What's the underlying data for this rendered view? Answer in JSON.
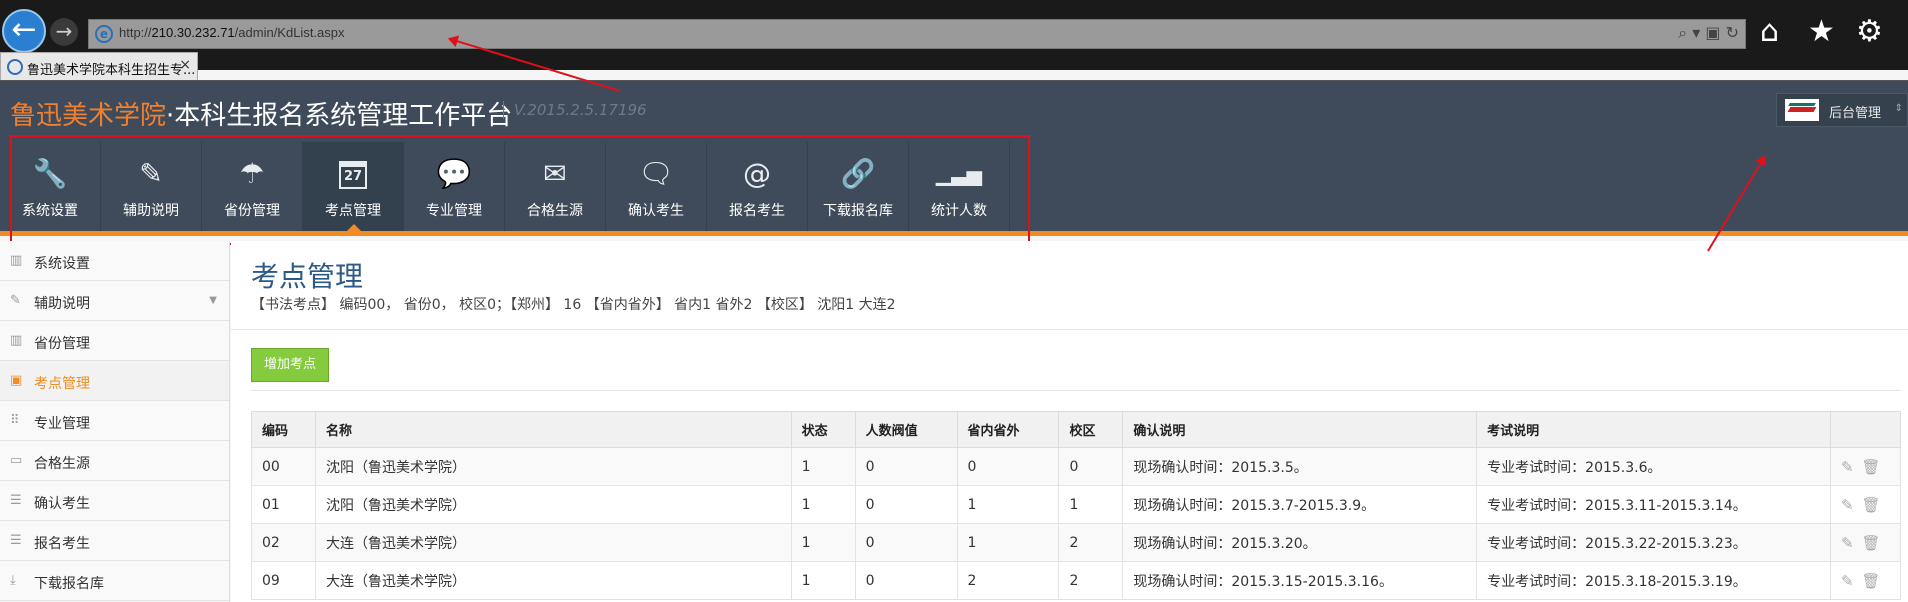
{
  "browser": {
    "url_prefix": "http://",
    "url_host": "210.30.232.71",
    "url_path": "/admin/KdList.aspx",
    "tab_title": "鲁迅美术学院本科生招生专...",
    "tab_close": "×",
    "back_glyph": "←",
    "forward_glyph": "→",
    "addr_controls": "⌕ ▾ ▣ ↻",
    "home_icon": "⌂",
    "favorites_icon": "★",
    "tools_icon": "⚙"
  },
  "header": {
    "brand_school": "鲁迅美术学院",
    "brand_title": "·本科生报名系统管理工作平台",
    "version": "V.2015.2.5.17196",
    "admin_label": "后台管理",
    "admin_caret": "⇕"
  },
  "topnav": {
    "items": [
      {
        "label": "系统设置",
        "icon": "wrench-icon",
        "glyph": "🔧"
      },
      {
        "label": "辅助说明",
        "icon": "pencil-icon",
        "glyph": "✎"
      },
      {
        "label": "省份管理",
        "icon": "umbrella-icon",
        "glyph": "☂"
      },
      {
        "label": "考点管理",
        "icon": "calendar-icon",
        "glyph": "27"
      },
      {
        "label": "专业管理",
        "icon": "speech-bubble-icon",
        "glyph": "💬"
      },
      {
        "label": "合格生源",
        "icon": "envelope-icon",
        "glyph": "✉"
      },
      {
        "label": "确认考生",
        "icon": "chat-icon",
        "glyph": "🗨"
      },
      {
        "label": "报名考生",
        "icon": "at-document-icon",
        "glyph": "@"
      },
      {
        "label": "下载报名库",
        "icon": "link-icon",
        "glyph": "🔗"
      },
      {
        "label": "统计人数",
        "icon": "bar-chart-icon",
        "glyph": "▁▃▅"
      }
    ],
    "active_index": 3
  },
  "sidebar": {
    "items": [
      {
        "label": "系统设置",
        "icon": "grid-icon",
        "glyph": "▥"
      },
      {
        "label": "辅助说明",
        "icon": "pencil-icon",
        "glyph": "✎",
        "caret": "▼"
      },
      {
        "label": "省份管理",
        "icon": "grid-icon",
        "glyph": "▥"
      },
      {
        "label": "考点管理",
        "icon": "calendar-icon",
        "glyph": "▣"
      },
      {
        "label": "专业管理",
        "icon": "dots-icon",
        "glyph": "⠿"
      },
      {
        "label": "合格生源",
        "icon": "monitor-icon",
        "glyph": "▭"
      },
      {
        "label": "确认考生",
        "icon": "list-icon",
        "glyph": "☰"
      },
      {
        "label": "报名考生",
        "icon": "list-icon",
        "glyph": "☰"
      },
      {
        "label": "下载报名库",
        "icon": "download-icon",
        "glyph": "⤓"
      }
    ],
    "active_index": 3
  },
  "main": {
    "title": "考点管理",
    "subtitle": "【书法考点】 编码00， 省份0， 校区0；【郑州】 16 【省内省外】 省内1 省外2 【校区】 沈阳1 大连2",
    "add_button": "增加考点",
    "edit_icon": "✎",
    "delete_icon": "🗑",
    "table": {
      "headers": [
        "编码",
        "名称",
        "状态",
        "人数阀值",
        "省内省外",
        "校区",
        "确认说明",
        "考试说明",
        ""
      ],
      "rows": [
        [
          "00",
          "沈阳（鲁迅美术学院）",
          "1",
          "0",
          "0",
          "0",
          "现场确认时间：2015.3.5。",
          "专业考试时间：2015.3.6。"
        ],
        [
          "01",
          "沈阳（鲁迅美术学院）",
          "1",
          "0",
          "1",
          "1",
          "现场确认时间：2015.3.7-2015.3.9。",
          "专业考试时间：2015.3.11-2015.3.14。"
        ],
        [
          "02",
          "大连（鲁迅美术学院）",
          "1",
          "0",
          "1",
          "2",
          "现场确认时间：2015.3.20。",
          "专业考试时间：2015.3.22-2015.3.23。"
        ],
        [
          "09",
          "大连（鲁迅美术学院）",
          "1",
          "0",
          "2",
          "2",
          "现场确认时间：2015.3.15-2015.3.16。",
          "专业考试时间：2015.3.18-2015.3.19。"
        ]
      ]
    }
  },
  "colors": {
    "header_bg": "#3f4b5a",
    "accent_orange": "#f08c23",
    "add_button_green": "#84cc3d",
    "annotation_red": "#e0101a",
    "title_blue": "#2b5a87"
  }
}
